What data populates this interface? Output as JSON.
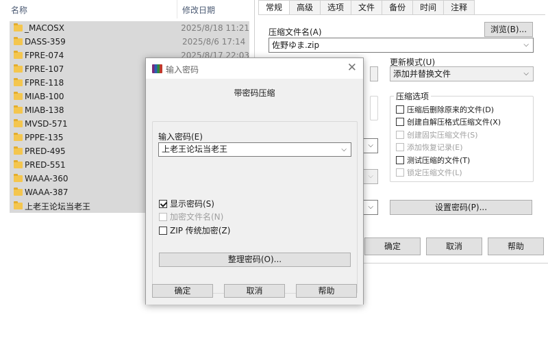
{
  "explorer": {
    "col_name": "名称",
    "col_date": "修改日期",
    "sort_indicator": "^",
    "files": [
      {
        "name": "_MACOSX",
        "date": "2025/8/18 11:21"
      },
      {
        "name": "DASS-359",
        "date": "2025/8/6 17:14"
      },
      {
        "name": "FPRE-074",
        "date": "2025/8/17 22:03"
      },
      {
        "name": "FPRE-107",
        "date": ""
      },
      {
        "name": "FPRE-118",
        "date": ""
      },
      {
        "name": "MIAB-100",
        "date": ""
      },
      {
        "name": "MIAB-138",
        "date": ""
      },
      {
        "name": "MVSD-571",
        "date": ""
      },
      {
        "name": "PPPE-135",
        "date": ""
      },
      {
        "name": "PRED-495",
        "date": ""
      },
      {
        "name": "PRED-551",
        "date": ""
      },
      {
        "name": "WAAA-360",
        "date": ""
      },
      {
        "name": "WAAA-387",
        "date": ""
      },
      {
        "name": "上老王论坛当老王",
        "date": ""
      }
    ]
  },
  "archive": {
    "tabs": [
      "常规",
      "高级",
      "选项",
      "文件",
      "备份",
      "时间",
      "注释"
    ],
    "archive_name_label": "压缩文件名(A)",
    "archive_name_value": "佐野ゆま.zip",
    "browse_button": "浏览(B)...",
    "update_mode_label": "更新模式(U)",
    "update_mode_value": "添加并替换文件",
    "options_title": "压缩选项",
    "options": [
      {
        "label": "压缩后删除原来的文件(D)",
        "checked": false,
        "enabled": true
      },
      {
        "label": "创建自解压格式压缩文件(X)",
        "checked": false,
        "enabled": true
      },
      {
        "label": "创建固实压缩文件(S)",
        "checked": false,
        "enabled": false
      },
      {
        "label": "添加恢复记录(E)",
        "checked": false,
        "enabled": false
      },
      {
        "label": "测试压缩的文件(T)",
        "checked": false,
        "enabled": true
      },
      {
        "label": "锁定压缩文件(L)",
        "checked": false,
        "enabled": false
      }
    ],
    "set_password_button": "设置密码(P)...",
    "ok_button": "确定",
    "cancel_button": "取消",
    "help_button": "帮助"
  },
  "password_dialog": {
    "title": "输入密码",
    "heading": "带密码压缩",
    "password_label": "输入密码(E)",
    "password_value": "上老王论坛当老王",
    "show_password": "显示密码(S)",
    "encrypt_filenames": "加密文件名(N)",
    "zip_legacy": "ZIP 传统加密(Z)",
    "organize_button": "整理密码(O)...",
    "ok_button": "确定",
    "cancel_button": "取消",
    "help_button": "帮助"
  }
}
